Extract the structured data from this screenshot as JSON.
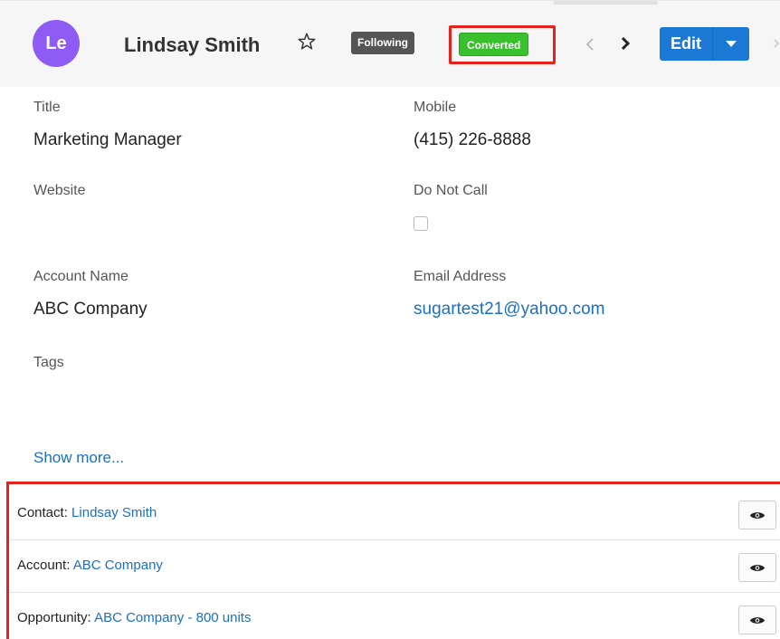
{
  "header": {
    "avatar_initials": "Le",
    "avatar_color": "#8e5bf5",
    "record_name": "Lindsay Smith",
    "following_label": "Following",
    "converted_label": "Converted",
    "edit_label": "Edit",
    "icons": [
      "star-icon",
      "chevron-left-icon",
      "chevron-right-icon",
      "caret-down-icon",
      "overflow-chevron-icon"
    ]
  },
  "fields": {
    "title_label": "Title",
    "title_value": "Marketing Manager",
    "mobile_label": "Mobile",
    "mobile_value": "(415) 226-8888",
    "website_label": "Website",
    "do_not_call_label": "Do Not Call",
    "do_not_call_checked": false,
    "account_name_label": "Account Name",
    "account_name_value": "ABC Company",
    "email_label": "Email Address",
    "email_value": "sugartest21@yahoo.com",
    "tags_label": "Tags"
  },
  "show_more": "Show more...",
  "converted_records": [
    {
      "type_label": "Contact:",
      "link": "Lindsay Smith"
    },
    {
      "type_label": "Account:",
      "link": "ABC Company"
    },
    {
      "type_label": "Opportunity:",
      "link": "ABC Company - 800 units"
    }
  ],
  "colors": {
    "accent_blue": "#1b78d5",
    "converted_green": "#39c12d",
    "highlight_red": "#e5231b",
    "link_blue": "#1b6fc7"
  }
}
